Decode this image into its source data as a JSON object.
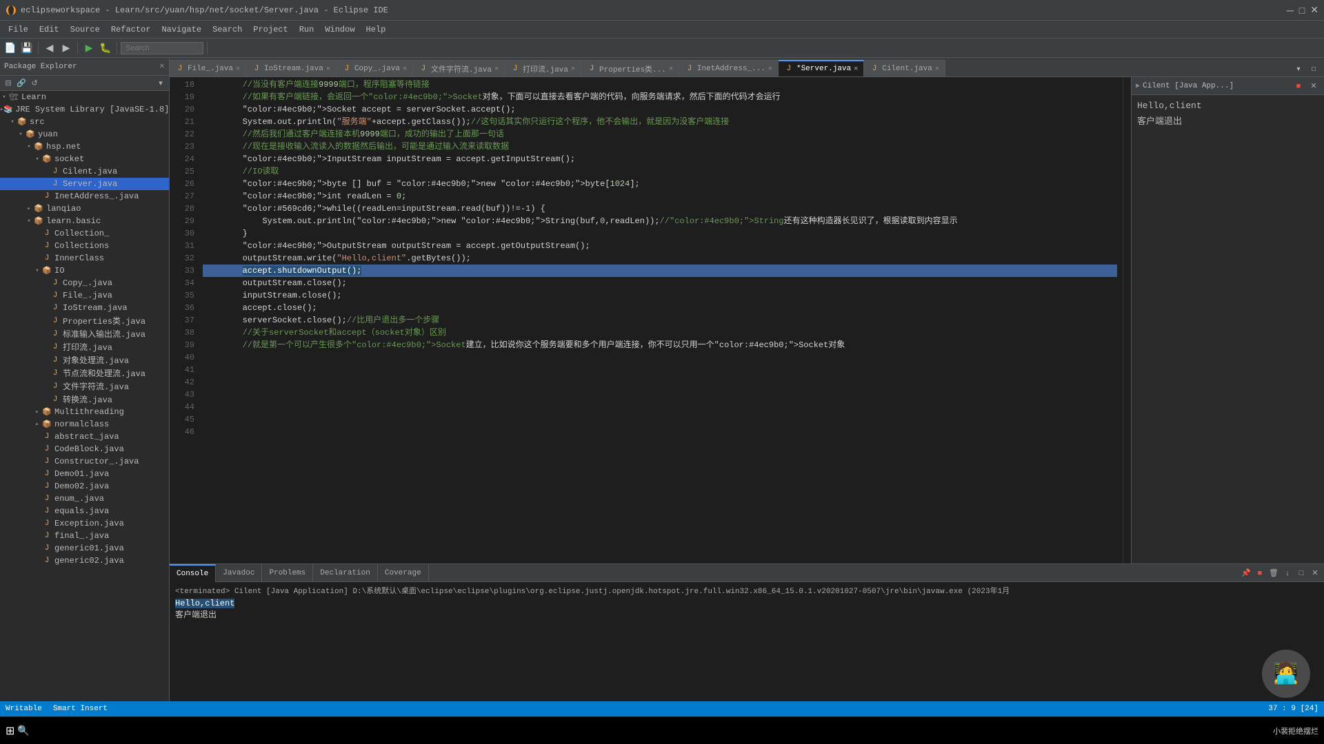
{
  "titlebar": {
    "title": "eclipseworkspace - Learn/src/yuan/hsp/net/socket/Server.java - Eclipse IDE",
    "icon": "eclipse"
  },
  "menubar": {
    "items": [
      "File",
      "Edit",
      "Source",
      "Refactor",
      "Navigate",
      "Search",
      "Project",
      "Run",
      "Window",
      "Help"
    ]
  },
  "toolbar": {
    "search_placeholder": "Search"
  },
  "package_explorer": {
    "title": "Package Explorer",
    "tree": [
      {
        "label": "Learn",
        "indent": 0,
        "type": "project",
        "expanded": true
      },
      {
        "label": "JRE System Library [JavaSE-1.8]",
        "indent": 1,
        "type": "library",
        "expanded": false
      },
      {
        "label": "src",
        "indent": 1,
        "type": "folder",
        "expanded": true
      },
      {
        "label": "yuan",
        "indent": 2,
        "type": "package",
        "expanded": true
      },
      {
        "label": "hsp.net",
        "indent": 3,
        "type": "package",
        "expanded": true
      },
      {
        "label": "socket",
        "indent": 4,
        "type": "package",
        "expanded": true
      },
      {
        "label": "Cilent.java",
        "indent": 5,
        "type": "java",
        "expanded": false
      },
      {
        "label": "Server.java",
        "indent": 5,
        "type": "java-selected",
        "expanded": false
      },
      {
        "label": "InetAddress_.java",
        "indent": 4,
        "type": "java",
        "expanded": false
      },
      {
        "label": "lanqiao",
        "indent": 3,
        "type": "package",
        "expanded": false
      },
      {
        "label": "learn.basic",
        "indent": 3,
        "type": "package",
        "expanded": true
      },
      {
        "label": "Collection_",
        "indent": 4,
        "type": "java",
        "expanded": false
      },
      {
        "label": "Collections",
        "indent": 4,
        "type": "java",
        "expanded": false
      },
      {
        "label": "InnerClass",
        "indent": 4,
        "type": "java",
        "expanded": false
      },
      {
        "label": "IO",
        "indent": 4,
        "type": "package",
        "expanded": true
      },
      {
        "label": "Copy_.java",
        "indent": 5,
        "type": "java",
        "expanded": false
      },
      {
        "label": "File_.java",
        "indent": 5,
        "type": "java",
        "expanded": false
      },
      {
        "label": "IoStream.java",
        "indent": 5,
        "type": "java",
        "expanded": false
      },
      {
        "label": "Properties类.java",
        "indent": 5,
        "type": "java",
        "expanded": false
      },
      {
        "label": "标准输入输出流.java",
        "indent": 5,
        "type": "java",
        "expanded": false
      },
      {
        "label": "打印流.java",
        "indent": 5,
        "type": "java",
        "expanded": false
      },
      {
        "label": "对象处理流.java",
        "indent": 5,
        "type": "java",
        "expanded": false
      },
      {
        "label": "节点流和处理流.java",
        "indent": 5,
        "type": "java",
        "expanded": false
      },
      {
        "label": "文件字符流.java",
        "indent": 5,
        "type": "java",
        "expanded": false
      },
      {
        "label": "转换流.java",
        "indent": 5,
        "type": "java",
        "expanded": false
      },
      {
        "label": "Multithreading",
        "indent": 4,
        "type": "package",
        "expanded": false
      },
      {
        "label": "normalclass",
        "indent": 4,
        "type": "package",
        "expanded": false
      },
      {
        "label": "abstract_java",
        "indent": 4,
        "type": "java",
        "expanded": false
      },
      {
        "label": "CodeBlock.java",
        "indent": 4,
        "type": "java",
        "expanded": false
      },
      {
        "label": "Constructor_.java",
        "indent": 4,
        "type": "java",
        "expanded": false
      },
      {
        "label": "Demo01.java",
        "indent": 4,
        "type": "java",
        "expanded": false
      },
      {
        "label": "Demo02.java",
        "indent": 4,
        "type": "java",
        "expanded": false
      },
      {
        "label": "enum_.java",
        "indent": 4,
        "type": "java",
        "expanded": false
      },
      {
        "label": "equals.java",
        "indent": 4,
        "type": "java",
        "expanded": false
      },
      {
        "label": "Exception.java",
        "indent": 4,
        "type": "java",
        "expanded": false
      },
      {
        "label": "final_.java",
        "indent": 4,
        "type": "java",
        "expanded": false
      },
      {
        "label": "generic01.java",
        "indent": 4,
        "type": "java",
        "expanded": false
      },
      {
        "label": "generic02.java",
        "indent": 4,
        "type": "java",
        "expanded": false
      }
    ]
  },
  "editor_tabs": [
    {
      "label": "File_.java",
      "icon": "java",
      "active": false,
      "modified": false
    },
    {
      "label": "IoStream.java",
      "icon": "java",
      "active": false,
      "modified": false
    },
    {
      "label": "Copy_.java",
      "icon": "java",
      "active": false,
      "modified": false
    },
    {
      "label": "文件字符流.java",
      "icon": "java",
      "active": false,
      "modified": false
    },
    {
      "label": "打印流.java",
      "icon": "java",
      "active": false,
      "modified": false
    },
    {
      "label": "Properties类...",
      "icon": "java",
      "active": false,
      "modified": false
    },
    {
      "label": "InetAddress_...",
      "icon": "java",
      "active": false,
      "modified": false
    },
    {
      "label": "*Server.java",
      "icon": "java",
      "active": true,
      "modified": true
    },
    {
      "label": "Cilent.java",
      "icon": "java",
      "active": false,
      "modified": false
    }
  ],
  "code": {
    "lines": [
      {
        "num": 18,
        "text": "        //当没有客户端连接9999端口，程序阻塞等待链接",
        "highlight": false
      },
      {
        "num": 19,
        "text": "        //如果有客户端链接，会返回一个Socket对象，下面可以直接去看客户端的代码，向服务端请求，然后下面的代码才会运行",
        "highlight": false
      },
      {
        "num": 20,
        "text": "        Socket accept = serverSocket.accept();",
        "highlight": false
      },
      {
        "num": 21,
        "text": "        System.out.println(\"服务端\"+accept.getClass());//这句话其实你只运行这个程序，他不会输出，就是因为没客户端连接",
        "highlight": false
      },
      {
        "num": 22,
        "text": "        //然后我们通过客户端连接本机9999端口，成功的输出了上面那一句话",
        "highlight": false
      },
      {
        "num": 23,
        "text": "",
        "highlight": false
      },
      {
        "num": 24,
        "text": "        //现在是接收输入流读入的数据然后输出，可能是通过输入流来读取数据",
        "highlight": false
      },
      {
        "num": 25,
        "text": "        InputStream inputStream = accept.getInputStream();",
        "highlight": false
      },
      {
        "num": 26,
        "text": "        //IO读取",
        "highlight": false
      },
      {
        "num": 27,
        "text": "        byte [] buf = new byte[1024];",
        "highlight": false
      },
      {
        "num": 28,
        "text": "        int readLen = 0;",
        "highlight": false
      },
      {
        "num": 29,
        "text": "        while((readLen=inputStream.read(buf))!=-1) {",
        "highlight": false
      },
      {
        "num": 30,
        "text": "            System.out.println(new String(buf,0,readLen));//String还有这种构造器长见识了，根据读取到内容显示",
        "highlight": false
      },
      {
        "num": 31,
        "text": "        }",
        "highlight": false
      },
      {
        "num": 32,
        "text": "",
        "highlight": false
      },
      {
        "num": 33,
        "text": "",
        "highlight": false
      },
      {
        "num": 34,
        "text": "        OutputStream outputStream = accept.getOutputStream();",
        "highlight": false
      },
      {
        "num": 35,
        "text": "        outputStream.write(\"Hello,client\".getBytes());",
        "highlight": false
      },
      {
        "num": 36,
        "text": "",
        "highlight": false
      },
      {
        "num": 37,
        "text": "        accept.shutdownOutput();",
        "highlight": true
      },
      {
        "num": 38,
        "text": "",
        "highlight": false
      },
      {
        "num": 39,
        "text": "",
        "highlight": false
      },
      {
        "num": 40,
        "text": "        outputStream.close();",
        "highlight": false
      },
      {
        "num": 41,
        "text": "",
        "highlight": false
      },
      {
        "num": 42,
        "text": "        inputStream.close();",
        "highlight": false
      },
      {
        "num": 43,
        "text": "        accept.close();",
        "highlight": false
      },
      {
        "num": 44,
        "text": "        serverSocket.close();//比用户退出多一个步骤",
        "highlight": false
      },
      {
        "num": 45,
        "text": "        //关于serverSocket和accept（socket对象）区别",
        "highlight": false
      },
      {
        "num": 46,
        "text": "        //就是第一个可以产生很多个Socket建立，比如说你这个服务端要和多个用户端连接，你不可以只用一个Socket对象",
        "highlight": false
      }
    ]
  },
  "right_panel": {
    "title": "Cilent [Java App...]",
    "hello_client": "Hello,client",
    "client_exit": "客户端退出"
  },
  "bottom_panel": {
    "tabs": [
      "Console",
      "Javadoc",
      "Problems",
      "Declaration",
      "Coverage"
    ],
    "active_tab": "Console",
    "console_text": "<terminated> Cilent [Java Application] D:\\系统默认\\桌面\\eclipse\\eclipse\\plugins\\org.eclipse.justj.openjdk.hotspot.jre.full.win32.x86_64_15.0.1.v20201027-0507\\jre\\bin\\javaw.exe  (2023年1月",
    "hello_selected": "Hello,client",
    "client_exit": "客户端退出"
  },
  "status_bar": {
    "writable": "Writable",
    "smart_insert": "Smart Insert",
    "position": "37 : 9 [24]"
  }
}
